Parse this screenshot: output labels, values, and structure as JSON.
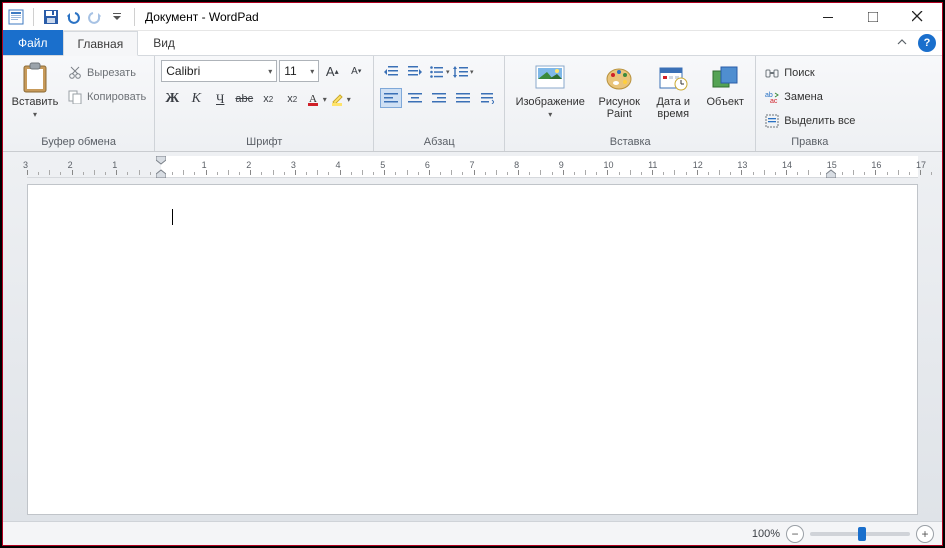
{
  "title": "Документ - WordPad",
  "tabs": {
    "file": "Файл",
    "home": "Главная",
    "view": "Вид"
  },
  "clipboard": {
    "paste": "Вставить",
    "cut": "Вырезать",
    "copy": "Копировать",
    "caption": "Буфер обмена"
  },
  "font": {
    "family": "Calibri",
    "size": "11",
    "caption": "Шрифт",
    "bold": "Ж",
    "italic": "К",
    "underline": "Ч",
    "strike": "abc"
  },
  "paragraph": {
    "caption": "Абзац"
  },
  "insert": {
    "image": "Изображение",
    "paint": "Рисунок Paint",
    "datetime": "Дата и время",
    "object": "Объект",
    "caption": "Вставка"
  },
  "editing": {
    "find": "Поиск",
    "replace": "Замена",
    "selectall": "Выделить все",
    "caption": "Правка"
  },
  "status": {
    "zoom": "100%"
  },
  "ruler": {
    "start": -3,
    "end": 17,
    "left_margin_cm": 3
  }
}
